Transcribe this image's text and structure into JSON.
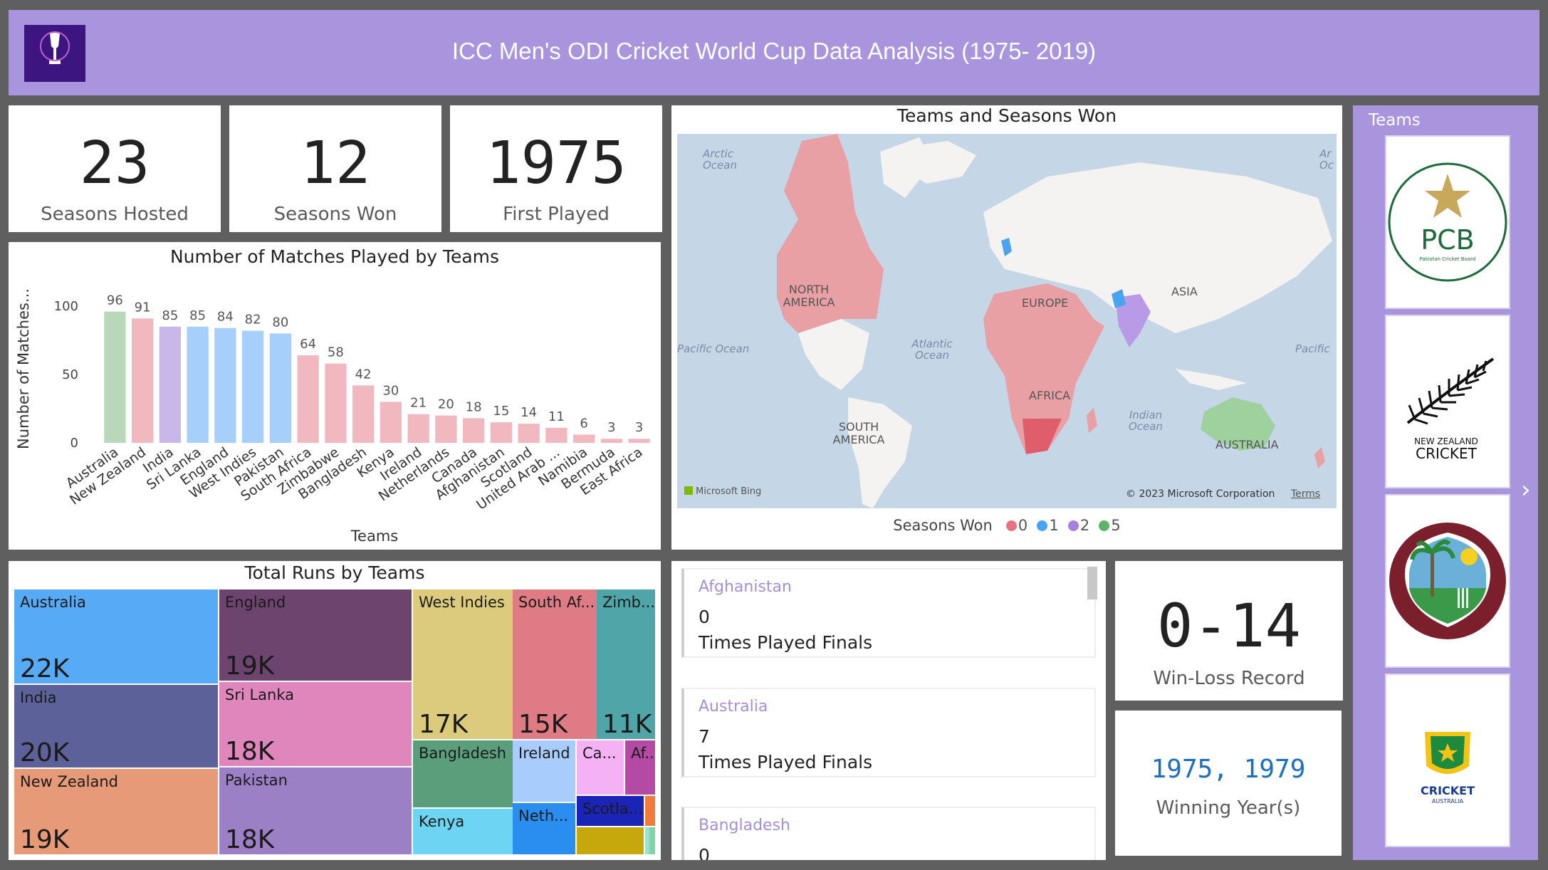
{
  "header": {
    "title": "ICC Men's ODI Cricket World Cup Data Analysis (1975- 2019)"
  },
  "kpis": [
    {
      "value": "23",
      "label": "Seasons Hosted"
    },
    {
      "value": "12",
      "label": "Seasons Won"
    },
    {
      "value": "1975",
      "label": "First Played"
    }
  ],
  "colors": {
    "header": "#a994de",
    "grey": "#b9d8b9",
    "pink": "#f2b8bf",
    "lavender": "#c9b7ea",
    "blue": "#a6d0fb",
    "accent_text": "#1a6fc0"
  },
  "bar_chart": {
    "chart_data": {
      "type": "bar",
      "title": "Number of Matches Played by Teams",
      "xlabel": "Teams",
      "ylabel": "Number of Matches...",
      "ylim": [
        0,
        100
      ],
      "yticks": [
        "0",
        "50",
        "100"
      ],
      "categories": [
        "Australia",
        "New Zealand",
        "India",
        "Sri Lanka",
        "England",
        "West Indies",
        "Pakistan",
        "South Africa",
        "Zimbabwe",
        "Bangladesh",
        "Kenya",
        "Ireland",
        "Netherlands",
        "Canada",
        "Afghanistan",
        "Scotland",
        "United Arab ...",
        "Namibia",
        "Bermuda",
        "East Africa"
      ],
      "values": [
        96,
        91,
        85,
        85,
        84,
        82,
        80,
        64,
        58,
        42,
        30,
        21,
        20,
        18,
        15,
        14,
        11,
        6,
        3,
        3
      ],
      "bar_colors": [
        "#b9d8b9",
        "#f2b8bf",
        "#c9b7ea",
        "#a6d0fb",
        "#a6d0fb",
        "#a6d0fb",
        "#a6d0fb",
        "#f2b8bf",
        "#f2b8bf",
        "#f2b8bf",
        "#f2b8bf",
        "#f2b8bf",
        "#f2b8bf",
        "#f2b8bf",
        "#f2b8bf",
        "#f2b8bf",
        "#f2b8bf",
        "#f2b8bf",
        "#f2b8bf",
        "#f2b8bf"
      ]
    }
  },
  "map": {
    "title": "Teams and Seasons Won",
    "labels": {
      "north_america": "NORTH AMERICA",
      "south_america": "SOUTH AMERICA",
      "europe": "EUROPE",
      "asia": "ASIA",
      "africa": "AFRICA",
      "australia": "AUSTRALIA",
      "arctic": "Arctic Ocean",
      "arctic2": "Ar Oc",
      "pacific_left": "Pacific Ocean",
      "pacific_right": "Pacific",
      "atlantic": "Atlantic Ocean",
      "indian": "Indian Ocean"
    },
    "bing": "Microsoft Bing",
    "copyright": "© 2023 Microsoft Corporation",
    "terms": "Terms",
    "legend_title": "Seasons Won",
    "legend": [
      {
        "label": "0",
        "color": "#e8737e"
      },
      {
        "label": "1",
        "color": "#4aa3f0"
      },
      {
        "label": "2",
        "color": "#a67fe0"
      },
      {
        "label": "5",
        "color": "#5ab56a"
      }
    ]
  },
  "treemap": {
    "title": "Total Runs by Teams",
    "items": [
      {
        "name": "Australia",
        "value": "22K",
        "color": "#57aaf5"
      },
      {
        "name": "India",
        "value": "20K",
        "color": "#5c6199"
      },
      {
        "name": "New Zealand",
        "value": "19K",
        "color": "#e69a78"
      },
      {
        "name": "England",
        "value": "19K",
        "color": "#6c446e"
      },
      {
        "name": "Sri Lanka",
        "value": "18K",
        "color": "#df86bd"
      },
      {
        "name": "Pakistan",
        "value": "18K",
        "color": "#9c80c6"
      },
      {
        "name": "West Indies",
        "value": "17K",
        "color": "#dccb7c"
      },
      {
        "name": "South Af...",
        "value": "15K",
        "color": "#df7b84"
      },
      {
        "name": "Zimb...",
        "value": "11K",
        "color": "#4fa5a8"
      },
      {
        "name": "Bangladesh",
        "value": "",
        "color": "#5b9e7c"
      },
      {
        "name": "Kenya",
        "value": "",
        "color": "#6dd4f3"
      },
      {
        "name": "Ireland",
        "value": "",
        "color": "#a8cdfc"
      },
      {
        "name": "Neth...",
        "value": "",
        "color": "#2a8df0"
      },
      {
        "name": "Ca...",
        "value": "",
        "color": "#f4b2f4"
      },
      {
        "name": "Af...",
        "value": "",
        "color": "#b44aa3"
      },
      {
        "name": "Scotla...",
        "value": "",
        "color": "#1a25b8"
      },
      {
        "name": "",
        "value": "",
        "color": "#c7a80c"
      },
      {
        "name": "",
        "value": "",
        "color": "#f07b3c"
      },
      {
        "name": "",
        "value": "",
        "color": "#9fdfd2"
      },
      {
        "name": "",
        "value": "",
        "color": "#7ed6a8"
      }
    ]
  },
  "finals": {
    "cards": [
      {
        "team": "Afghanistan",
        "count": "0",
        "label": "Times Played Finals"
      },
      {
        "team": "Australia",
        "count": "7",
        "label": "Times Played Finals"
      },
      {
        "team": "Bangladesh",
        "count": "0",
        "label": ""
      }
    ]
  },
  "record": {
    "value": "0-14",
    "label": "Win-Loss Record"
  },
  "winning": {
    "value": "1975, 1979",
    "label": "Winning Year(s)"
  },
  "teams_slicer": {
    "title": "Teams",
    "logos": [
      {
        "name": "pcb-logo",
        "text": "PCB",
        "subtext": "Pakistan Cricket Board"
      },
      {
        "name": "new-zealand-cricket-logo",
        "text1": "NEW ZEALAND",
        "text2": "CRICKET"
      },
      {
        "name": "west-indies-logo"
      },
      {
        "name": "cricket-australia-logo",
        "text1": "CRICKET",
        "text2": "AUSTRALIA"
      }
    ],
    "next": "›"
  }
}
